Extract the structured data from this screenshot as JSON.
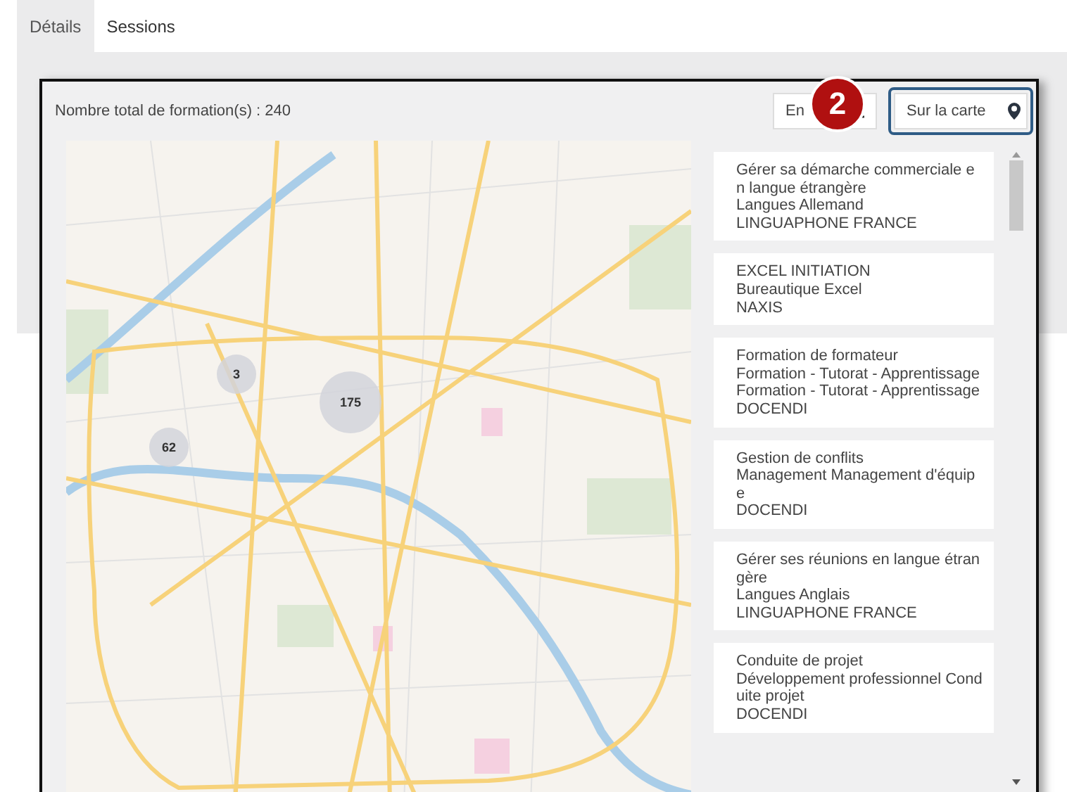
{
  "tabs": [
    {
      "label": "Détails",
      "selected": true
    },
    {
      "label": "Sessions",
      "selected": false
    }
  ],
  "summary": "Nombre total de formation(s) : 240",
  "view_toggle": [
    {
      "kind": "list",
      "label": "En",
      "highlighted": false
    },
    {
      "kind": "map",
      "label": "Sur la carte",
      "highlighted": true
    }
  ],
  "step_badge": "2",
  "map": {
    "clusters": [
      {
        "count": "3"
      },
      {
        "count": "175"
      },
      {
        "count": "62"
      }
    ]
  },
  "trainings": [
    {
      "title": "Gérer sa démarche commerciale en langue étrangère",
      "category": "Langues Allemand",
      "organization": "LINGUAPHONE FRANCE"
    },
    {
      "title": "EXCEL INITIATION",
      "category": "Bureautique Excel",
      "organization": "NAXIS"
    },
    {
      "title": "Formation de formateur",
      "category": "Formation - Tutorat - Apprentissage Formation - Tutorat - Apprentissage",
      "organization": "DOCENDI"
    },
    {
      "title": "Gestion de conflits",
      "category": "Management Management d'équipe",
      "organization": "DOCENDI"
    },
    {
      "title": "Gérer ses réunions en langue étrangère",
      "category": "Langues Anglais",
      "organization": "LINGUAPHONE FRANCE"
    },
    {
      "title": "Conduite de projet",
      "category": "Développement professionnel Conduite projet",
      "organization": "DOCENDI"
    }
  ]
}
